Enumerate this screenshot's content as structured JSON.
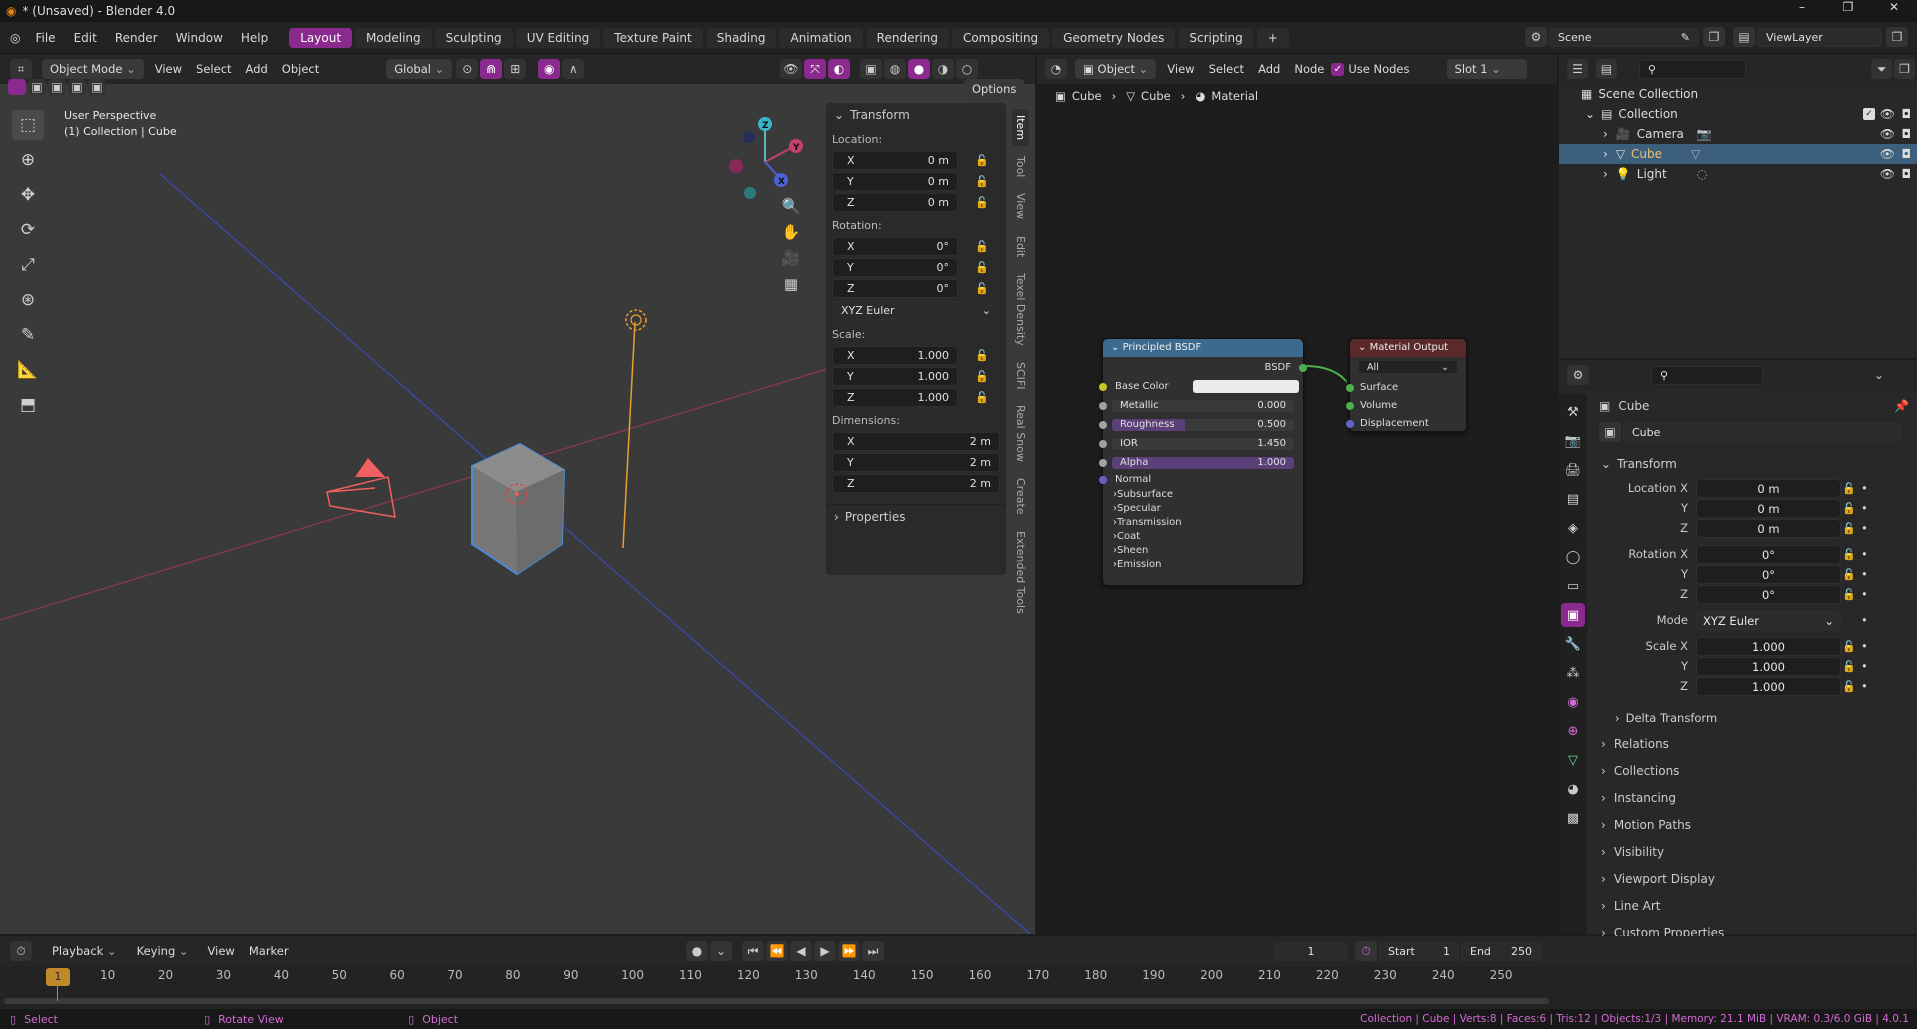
{
  "app": {
    "window_title": "* (Unsaved) - Blender 4.0",
    "win_controls": [
      "–",
      "❐",
      "✕"
    ]
  },
  "menu": {
    "items": [
      "File",
      "Edit",
      "Render",
      "Window",
      "Help"
    ]
  },
  "workspaces": [
    "Layout",
    "Modeling",
    "Sculpting",
    "UV Editing",
    "Texture Paint",
    "Shading",
    "Animation",
    "Rendering",
    "Compositing",
    "Geometry Nodes",
    "Scripting"
  ],
  "workspace_add": "+",
  "scene_name": "Scene",
  "view_layer": "ViewLayer",
  "viewport": {
    "mode": "Object Mode",
    "menus": [
      "View",
      "Select",
      "Add",
      "Object"
    ],
    "orientation": "Global",
    "options": "Options",
    "info_line1": "User Perspective",
    "info_line2": "(1) Collection | Cube",
    "gizmo_labels": {
      "x": "X",
      "y": "Y",
      "z": "Z"
    }
  },
  "npanel": {
    "transform_title": "Transform",
    "location_label": "Location:",
    "location": [
      {
        "axis": "X",
        "value": "0 m"
      },
      {
        "axis": "Y",
        "value": "0 m"
      },
      {
        "axis": "Z",
        "value": "0 m"
      }
    ],
    "rotation_label": "Rotation:",
    "rotation": [
      {
        "axis": "X",
        "value": "0°"
      },
      {
        "axis": "Y",
        "value": "0°"
      },
      {
        "axis": "Z",
        "value": "0°"
      }
    ],
    "rotation_mode": "XYZ Euler",
    "scale_label": "Scale:",
    "scale": [
      {
        "axis": "X",
        "value": "1.000"
      },
      {
        "axis": "Y",
        "value": "1.000"
      },
      {
        "axis": "Z",
        "value": "1.000"
      }
    ],
    "dimensions_label": "Dimensions:",
    "dimensions": [
      {
        "axis": "X",
        "value": "2 m"
      },
      {
        "axis": "Y",
        "value": "2 m"
      },
      {
        "axis": "Z",
        "value": "2 m"
      }
    ],
    "properties_title": "Properties",
    "tabs": [
      "Item",
      "Tool",
      "View",
      "Edit",
      "Texel Density",
      "SCIFI",
      "Real Snow",
      "Create",
      "Extended Tools"
    ]
  },
  "node_editor": {
    "object_menu": "Object",
    "menus": [
      "View",
      "Select",
      "Add",
      "Node"
    ],
    "use_nodes": "Use Nodes",
    "slot": "Slot 1",
    "breadcrumb": [
      "Cube",
      "Cube",
      "Material"
    ],
    "bsdf": {
      "title": "Principled BSDF",
      "out": "BSDF",
      "base_color": "Base Color",
      "metallic_label": "Metallic",
      "metallic": "0.000",
      "roughness_label": "Roughness",
      "roughness": "0.500",
      "ior_label": "IOR",
      "ior": "1.450",
      "alpha_label": "Alpha",
      "alpha": "1.000",
      "normal": "Normal",
      "sections": [
        "Subsurface",
        "Specular",
        "Transmission",
        "Coat",
        "Sheen",
        "Emission"
      ]
    },
    "output": {
      "title": "Material Output",
      "target": "All",
      "inputs": [
        "Surface",
        "Volume",
        "Displacement"
      ]
    }
  },
  "outliner": {
    "root": "Scene Collection",
    "collection": "Collection",
    "items": [
      "Camera",
      "Cube",
      "Light"
    ]
  },
  "properties": {
    "object_name": "Cube",
    "name_field": "Cube",
    "transform": "Transform",
    "location_x_label": "Location X",
    "y_label": "Y",
    "z_label": "Z",
    "rotation_x_label": "Rotation X",
    "mode_label": "Mode",
    "scale_x_label": "Scale X",
    "location": [
      "0 m",
      "0 m",
      "0 m"
    ],
    "rotation": [
      "0°",
      "0°",
      "0°"
    ],
    "mode": "XYZ Euler",
    "scale": [
      "1.000",
      "1.000",
      "1.000"
    ],
    "delta": "Delta Transform",
    "panels": [
      "Relations",
      "Collections",
      "Instancing",
      "Motion Paths",
      "Visibility",
      "Viewport Display",
      "Line Art",
      "Custom Properties"
    ]
  },
  "timeline": {
    "menus": [
      "Playback",
      "Keying",
      "View",
      "Marker"
    ],
    "current_frame": "1",
    "start_label": "Start",
    "start": "1",
    "end_label": "End",
    "end": "250",
    "ticks": [
      "10",
      "20",
      "30",
      "40",
      "50",
      "60",
      "70",
      "80",
      "90",
      "100",
      "110",
      "120",
      "130",
      "140",
      "150",
      "160",
      "170",
      "180",
      "190",
      "200",
      "210",
      "220",
      "230",
      "240",
      "250"
    ],
    "playhead": "1"
  },
  "status": {
    "select": "Select",
    "rotate": "Rotate View",
    "object": "Object",
    "stats": "Collection | Cube | Verts:8 | Faces:6 | Tris:12 | Objects:1/3 | Memory: 21.1 MiB | VRAM: 0.3/6.0 GiB | 4.0.1"
  }
}
